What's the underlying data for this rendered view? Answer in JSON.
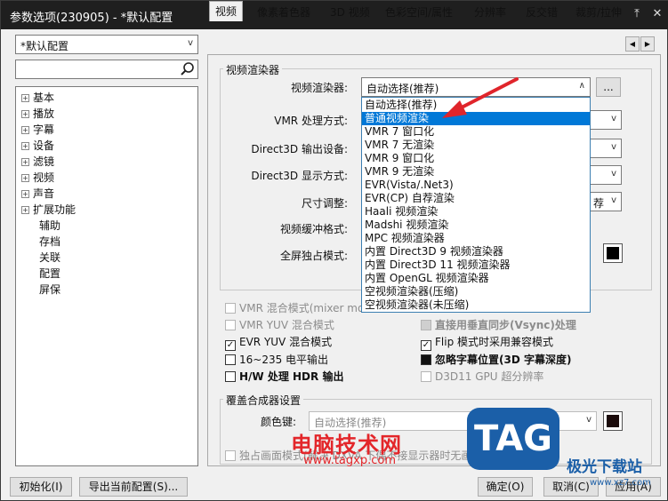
{
  "window": {
    "title": "参数选项(230905) - *默认配置"
  },
  "profile": {
    "selected": "*默认配置"
  },
  "tree": {
    "nodes": [
      "基本",
      "播放",
      "字幕",
      "设备",
      "滤镜",
      "视频",
      "声音",
      "扩展功能"
    ],
    "leaves": [
      "辅助",
      "存档",
      "关联",
      "配置",
      "屏保"
    ]
  },
  "tabs": [
    "视频",
    "像素着色器",
    "3D 视频",
    "色彩空间/属性",
    "分辨率",
    "反交错",
    "裁剪/拉伸"
  ],
  "renderer_group": {
    "title": "视频渲染器",
    "renderer_label": "视频渲染器:",
    "renderer_value": "自动选择(推荐)",
    "more_label": "...",
    "vmr_mode_label": "VMR 处理方式:",
    "d3d_device_label": "Direct3D 输出设备:",
    "d3d_display_label": "Direct3D 显示方式:",
    "resize_label": "尺寸调整:",
    "resize_value_partial": "荐",
    "buffer_label": "视频缓冲格式:",
    "fullscreen_label": "全屏独占模式:"
  },
  "dropdown": {
    "items": [
      "自动选择(推荐)",
      "普通视频渲染",
      "VMR 7 窗口化",
      "VMR 7 无渲染",
      "VMR 9 窗口化",
      "VMR 9 无渲染",
      "EVR(Vista/.Net3)",
      "EVR(CP) 自荐渲染",
      "Haali 视频渲染",
      "Madshi 视频渲染",
      "MPC 视频渲染器",
      "内置 Direct3D 9 视频渲染器",
      "内置 Direct3D 11 视频渲染器",
      "内置 OpenGL 视频渲染器",
      "空视频渲染器(压缩)",
      "空视频渲染器(未压缩)"
    ],
    "selected_index": 1
  },
  "options": {
    "vmr_mixer": "VMR 混合模式(mixer mo",
    "vmr_yuv": "VMR YUV 混合模式",
    "evr_yuv": "EVR YUV 混合模式",
    "range_16_235": "16~235 电平输出",
    "hw_hdr": "H/W 处理 HDR 输出",
    "vsync": "直接用垂直同步(Vsync)处理",
    "flip_compat": "Flip 模式时采用兼容模式",
    "ignore_sub_pos": "忽略字幕位置(3D 字幕深度)",
    "d3d11_gpu": "D3D11 GPU 超分辨率"
  },
  "overlay_group": {
    "title": "覆盖合成器设置",
    "color_key_label": "颜色键:",
    "color_key_value": "自动选择(推荐)",
    "exclusive_label": "独占画面模式(解决 DXVA 下偶不接显示器时无画面"
  },
  "buttons": {
    "init": "初始化(I)",
    "export": "导出当前配置(S)...",
    "ok": "确定(O)",
    "cancel": "取消(C)",
    "apply": "应用(A)"
  },
  "watermark": {
    "site_cn": "电脑技术网",
    "site_url": "www.tagxp.com",
    "logo": "TAG",
    "jiguang": "极光下载站",
    "jiguang_url": "www.xz7.com"
  },
  "colors": {
    "titlebar": "#1f1f1f",
    "selection": "#0078d7",
    "arrow": "#e0252b",
    "watermark_red": "#e3262a",
    "tag_blue": "#1b5fa8"
  }
}
